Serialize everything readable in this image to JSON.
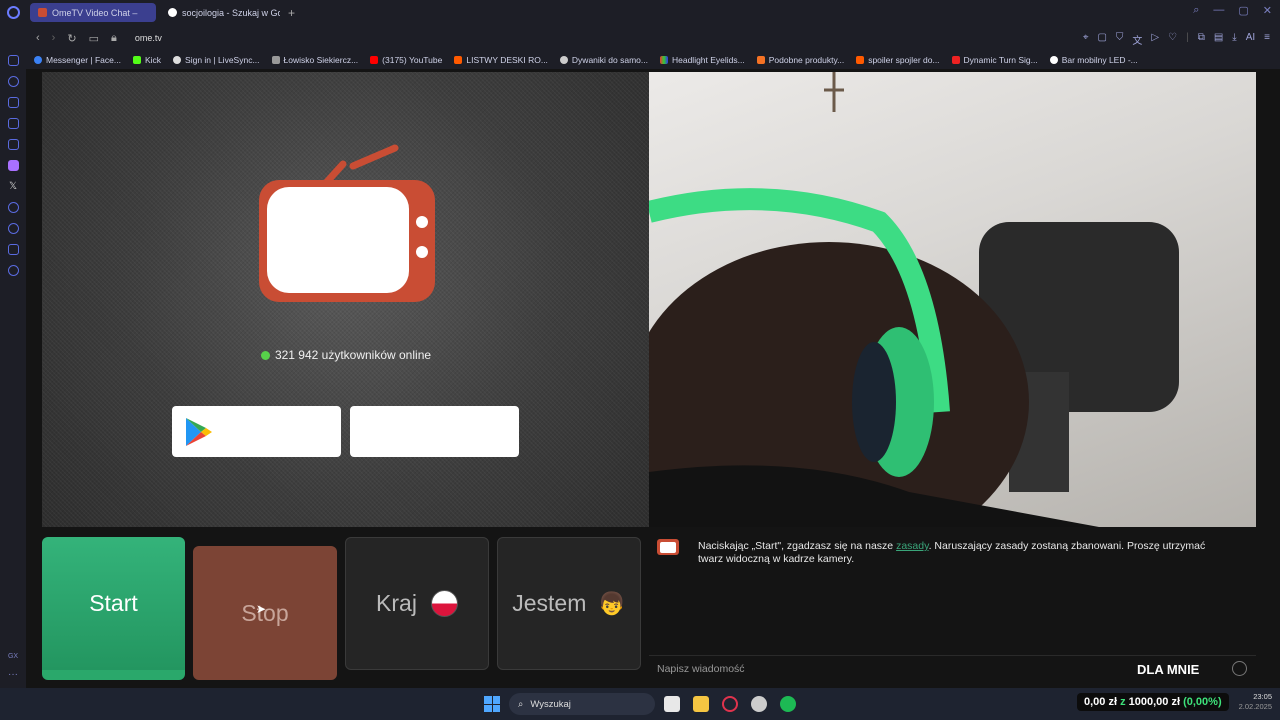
{
  "browser": {
    "tabs": [
      {
        "label": "OmeTV Video Chat –",
        "active": true
      },
      {
        "label": "socjoilogia - Szukaj w Go",
        "active": false
      }
    ],
    "new_tab": "+",
    "url": "ome.tv",
    "bookmarks": [
      "Messenger | Face...",
      "Kick",
      "Sign in | LiveSync...",
      "Łowisko Siekiercz...",
      "(3175) YouTube",
      "LISTWY DESKI RO...",
      "Dywaniki do samo...",
      "Headlight Eyelids...",
      "Podobne produkty...",
      "spoiler spojler do...",
      "Dynamic Turn Sig...",
      "Bar mobilny LED -..."
    ],
    "ai_label": "AI",
    "sidebar_gx": "GX"
  },
  "page": {
    "online_count": "321 942 użytkowników online",
    "buttons": {
      "start": "Start",
      "stop": "Stop",
      "kraj": "Kraj",
      "jestem": "Jestem"
    },
    "chat": {
      "msg_before": "Naciskając „Start\", zgadzasz się na nasze ",
      "rules_link": "zasady",
      "msg_after": ". Naruszający zasady zostaną zbanowani. Proszę utrzymać twarz widoczną w kadrze kamery.",
      "input_placeholder": "Napisz wiadomość",
      "dla_mnie": "DLA MNIE"
    },
    "colors": {
      "start": "#2aa86b",
      "stop": "#7c4435",
      "tv_logo": "#c94d34",
      "online_dot": "#57d04a"
    }
  },
  "taskbar": {
    "search_label": "Wyszukaj",
    "money_a": "0,00 zł",
    "money_z": "z",
    "money_b": "1000,00 zł",
    "money_pct": "(0,00%)",
    "time": "23:05",
    "date": "2.02.2025"
  }
}
